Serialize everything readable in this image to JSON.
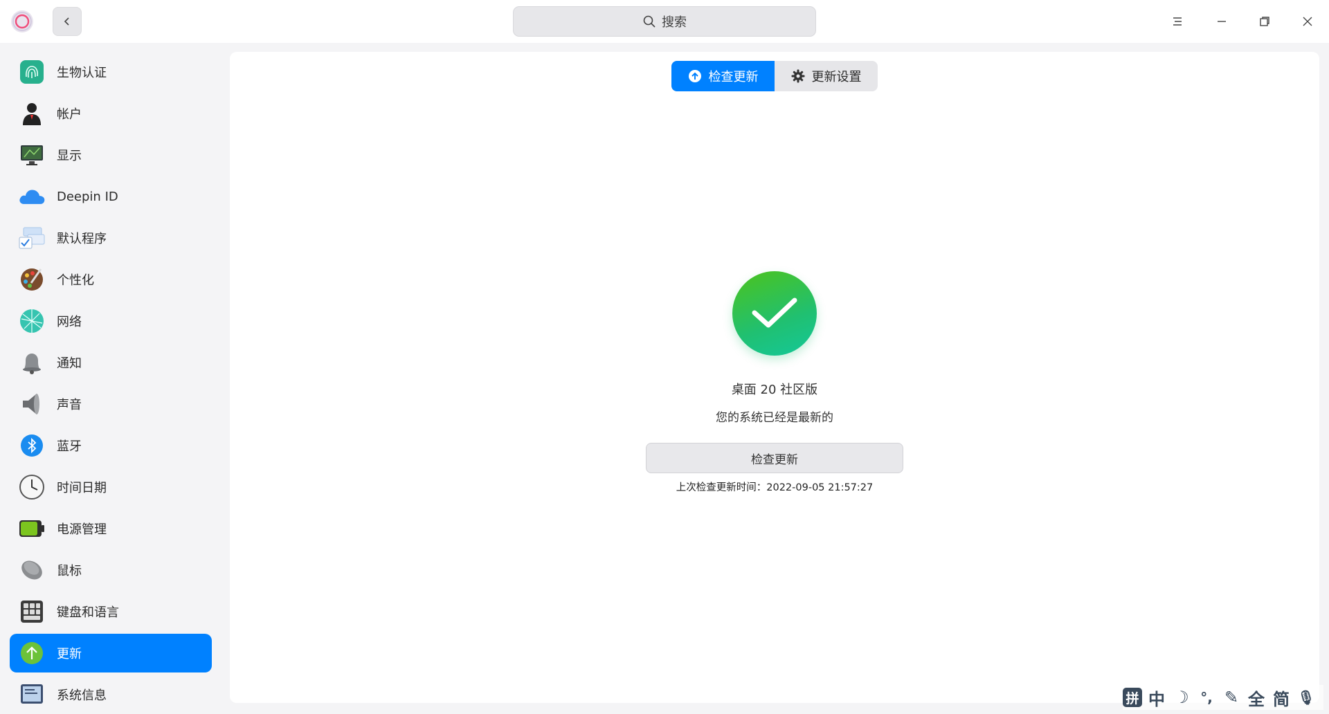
{
  "titlebar": {
    "search_placeholder": "搜索",
    "icons": [
      "app-logo-icon",
      "back-arrow-icon",
      "search-icon",
      "menu-icon",
      "minimize-icon",
      "maximize-icon",
      "close-icon"
    ]
  },
  "sidebar": {
    "items": [
      {
        "label": "生物认证",
        "icon": "fingerprint-icon"
      },
      {
        "label": "帐户",
        "icon": "account-icon"
      },
      {
        "label": "显示",
        "icon": "display-icon"
      },
      {
        "label": "Deepin ID",
        "icon": "cloud-icon"
      },
      {
        "label": "默认程序",
        "icon": "default-apps-icon"
      },
      {
        "label": "个性化",
        "icon": "palette-icon"
      },
      {
        "label": "网络",
        "icon": "network-icon"
      },
      {
        "label": "通知",
        "icon": "bell-icon"
      },
      {
        "label": "声音",
        "icon": "speaker-icon"
      },
      {
        "label": "蓝牙",
        "icon": "bluetooth-icon"
      },
      {
        "label": "时间日期",
        "icon": "clock-icon"
      },
      {
        "label": "电源管理",
        "icon": "battery-icon"
      },
      {
        "label": "鼠标",
        "icon": "mouse-icon"
      },
      {
        "label": "键盘和语言",
        "icon": "keyboard-icon"
      },
      {
        "label": "更新",
        "icon": "update-icon",
        "active": true
      },
      {
        "label": "系统信息",
        "icon": "system-info-icon"
      }
    ]
  },
  "main": {
    "tabs": [
      {
        "label": "检查更新",
        "active": true
      },
      {
        "label": "更新设置",
        "active": false
      }
    ],
    "version": "桌面 20 社区版",
    "status": "您的系统已经是最新的",
    "check_button": "检查更新",
    "last_check": "上次检查更新时间：2022-09-05 21:57:27"
  },
  "ime": {
    "keys": [
      "拼",
      "中",
      "☽",
      "°,",
      "✎",
      "全",
      "简",
      "🎙"
    ]
  },
  "colors": {
    "accent": "#0081ff",
    "success_start": "#4cc31c",
    "success_end": "#14c89a"
  }
}
